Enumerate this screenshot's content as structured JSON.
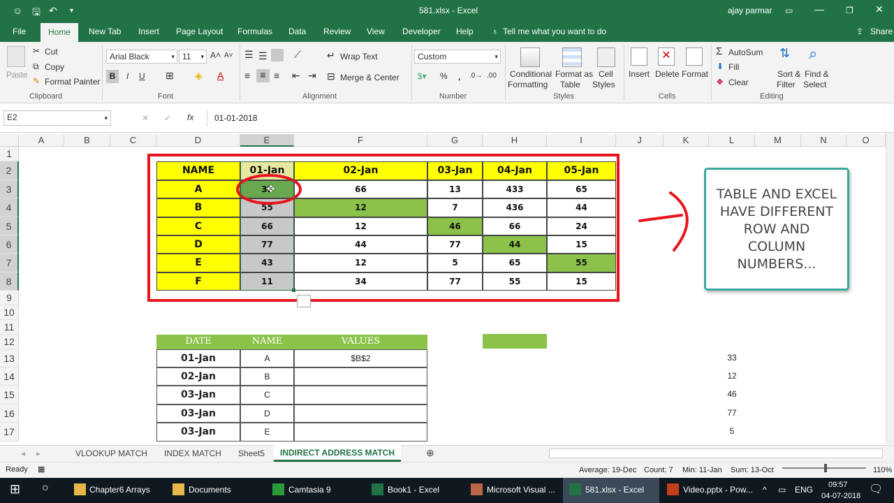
{
  "titlebar": {
    "title": "581.xlsx  -  Excel",
    "user": "ajay parmar"
  },
  "ribbon_tabs": [
    "File",
    "Home",
    "New Tab",
    "Insert",
    "Page Layout",
    "Formulas",
    "Data",
    "Review",
    "View",
    "Developer",
    "Help",
    "Tell me what you want to do",
    "Share"
  ],
  "clipboard": {
    "paste": "Paste",
    "cut": "Cut",
    "copy": "Copy",
    "format_painter": "Format Painter",
    "group": "Clipboard"
  },
  "font": {
    "name": "Arial Black",
    "size": "11",
    "bold": "B",
    "italic": "I",
    "underline": "U",
    "group": "Font"
  },
  "alignment": {
    "wrap": "Wrap Text",
    "merge": "Merge & Center",
    "group": "Alignment"
  },
  "number": {
    "format": "Custom",
    "group": "Number"
  },
  "styles": {
    "conditional": "Conditional",
    "formatting": "Formatting",
    "format_as": "Format as",
    "table": "Table",
    "cell": "Cell",
    "cell_styles": "Styles",
    "group": "Styles"
  },
  "cells": {
    "insert": "Insert",
    "delete": "Delete",
    "format": "Format",
    "group": "Cells"
  },
  "editing": {
    "autosum": "AutoSum",
    "fill": "Fill",
    "clear": "Clear",
    "sort": "Sort &",
    "filter": "Filter",
    "find": "Find &",
    "select": "Select",
    "group": "Editing"
  },
  "formula_bar": {
    "name_box": "E2",
    "fx": "fx",
    "value": "01-01-2018"
  },
  "columns": [
    "A",
    "B",
    "C",
    "D",
    "E",
    "F",
    "G",
    "H",
    "I",
    "J",
    "K",
    "L",
    "M",
    "N",
    "O"
  ],
  "rows": [
    "1",
    "2",
    "3",
    "4",
    "5",
    "6",
    "7",
    "8",
    "9",
    "10",
    "11",
    "12",
    "13",
    "14",
    "15",
    "16",
    "17"
  ],
  "table1": {
    "headers": [
      "NAME",
      "01-Jan",
      "02-Jan",
      "03-Jan",
      "04-Jan",
      "05-Jan"
    ],
    "rows": [
      [
        "A",
        "33",
        "66",
        "13",
        "433",
        "65"
      ],
      [
        "B",
        "55",
        "12",
        "7",
        "436",
        "44"
      ],
      [
        "C",
        "66",
        "12",
        "46",
        "66",
        "24"
      ],
      [
        "D",
        "77",
        "44",
        "77",
        "44",
        "15"
      ],
      [
        "E",
        "43",
        "12",
        "5",
        "65",
        "55"
      ],
      [
        "F",
        "11",
        "34",
        "77",
        "55",
        "15"
      ]
    ]
  },
  "callout": "TABLE AND EXCEL HAVE DIFFERENT ROW AND COLUMN NUMBERS...",
  "table2": {
    "headers": [
      "DATE",
      "NAME",
      "VALUES"
    ],
    "rows": [
      [
        "01-Jan",
        "A",
        "$B$2"
      ],
      [
        "02-Jan",
        "B",
        ""
      ],
      [
        "03-Jan",
        "C",
        ""
      ],
      [
        "03-Jan",
        "D",
        ""
      ],
      [
        "03-Jan",
        "E",
        ""
      ]
    ]
  },
  "col_l_values": [
    "33",
    "12",
    "46",
    "77",
    "5"
  ],
  "sheets": [
    "VLOOKUP MATCH",
    "INDEX MATCH",
    "Sheet5",
    "INDIRECT ADDRESS MATCH"
  ],
  "status": {
    "ready": "Ready",
    "average": "Average: 19-Dec",
    "count": "Count: 7",
    "min": "Min: 11-Jan",
    "sum": "Sum: 13-Oct",
    "zoom": "110%"
  },
  "taskbar": {
    "items": [
      "Chapter6 Arrays",
      "Documents",
      "Camtasia 9",
      "Book1 - Excel",
      "Microsoft Visual ...",
      "581.xlsx - Excel",
      "Video.pptx - Pow..."
    ],
    "lang": "ENG",
    "time": "09:57",
    "date": "04-07-2018"
  },
  "colors": {
    "excel_green": "#217346",
    "yellow": "#ffff00",
    "cell_green": "#8bc34a",
    "grey_selected": "#c8c8c8",
    "red": "#e8141e",
    "callout_border": "#3aa89a"
  }
}
